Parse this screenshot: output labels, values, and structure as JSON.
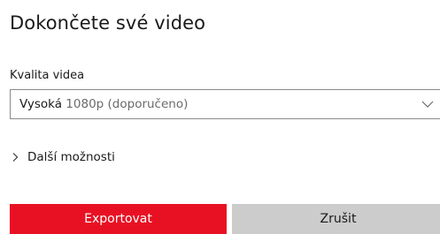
{
  "dialog": {
    "title": "Dokončete své video"
  },
  "quality": {
    "label": "Kvalita videa",
    "selected_primary": "Vysoká",
    "selected_secondary": " 1080p (doporučeno)"
  },
  "more_options": {
    "label": "Další možnosti"
  },
  "buttons": {
    "export_label": "Exportovat",
    "cancel_label": "Zrušit"
  },
  "colors": {
    "accent": "#e81123",
    "secondary_button": "#cccccc",
    "border": "#8a8a8a"
  },
  "icons": {
    "dropdown": "chevron-down-icon",
    "expander": "chevron-right-icon"
  }
}
